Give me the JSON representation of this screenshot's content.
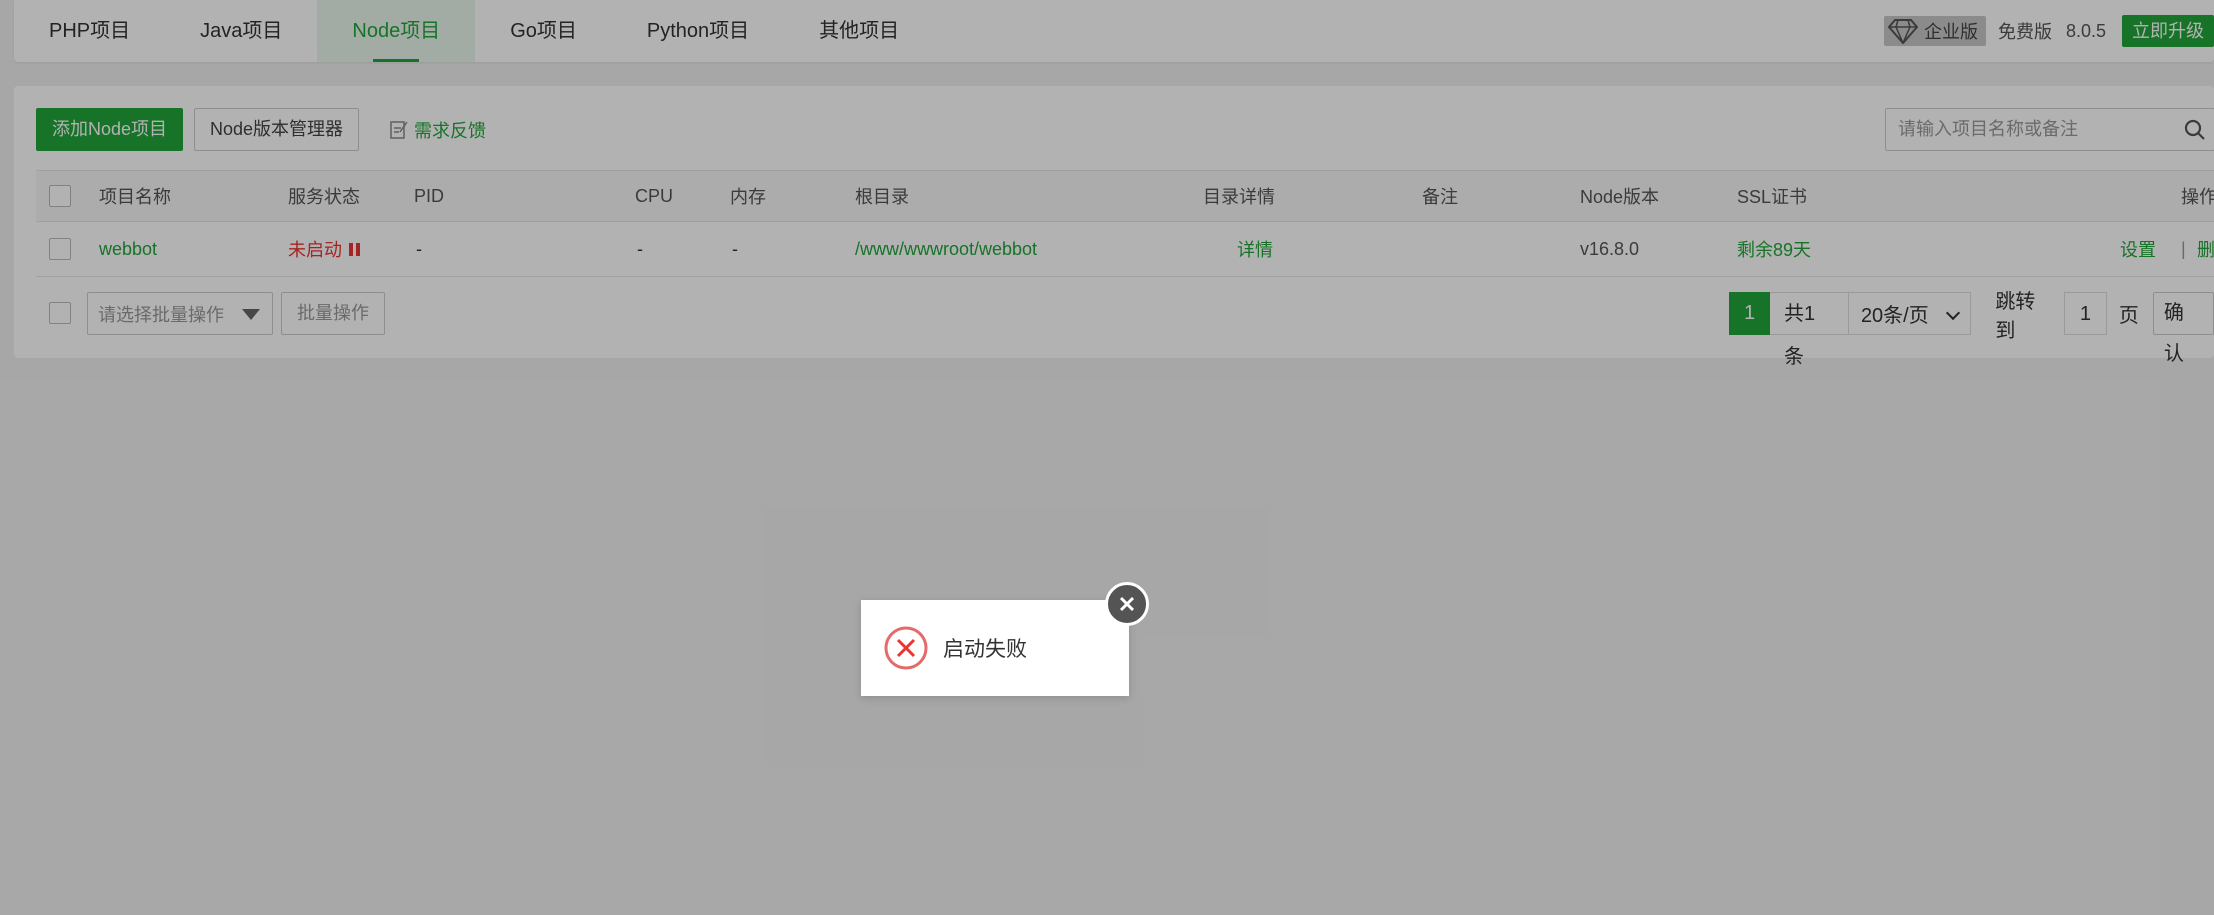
{
  "tabs": [
    {
      "label": "PHP项目"
    },
    {
      "label": "Java项目"
    },
    {
      "label": "Node项目",
      "active": true
    },
    {
      "label": "Go项目"
    },
    {
      "label": "Python项目"
    },
    {
      "label": "其他项目"
    }
  ],
  "top_right": {
    "edition": "企业版",
    "free": "免费版",
    "version": "8.0.5",
    "upgrade": "立即升级"
  },
  "toolbar": {
    "add_node": "添加Node项目",
    "version_manager": "Node版本管理器",
    "feedback": "需求反馈",
    "search_placeholder": "请输入项目名称或备注"
  },
  "table": {
    "headers": {
      "name": "项目名称",
      "status": "服务状态",
      "pid": "PID",
      "cpu": "CPU",
      "mem": "内存",
      "root": "根目录",
      "detail": "目录详情",
      "note": "备注",
      "node_version": "Node版本",
      "ssl": "SSL证书",
      "ops": "操作"
    },
    "rows": [
      {
        "name": "webbot",
        "status": "未启动",
        "pid": "-",
        "cpu": "-",
        "mem": "-",
        "root": "/www/wwwroot/webbot",
        "detail": "详情",
        "note": "",
        "node_version": "v16.8.0",
        "ssl": "剩余89天",
        "op_settings": "设置",
        "op_sep": "|",
        "op_delete": "删除"
      }
    ]
  },
  "footer": {
    "batch_placeholder": "请选择批量操作",
    "batch_button": "批量操作",
    "page_current": "1",
    "total": "共1条",
    "page_size": "20条/页",
    "jump_label": "跳转到",
    "jump_value": "1",
    "page_unit": "页",
    "confirm": "确认"
  },
  "toast": {
    "message": "启动失败"
  },
  "colors": {
    "accent": "#20a53a",
    "error": "#e33333"
  }
}
